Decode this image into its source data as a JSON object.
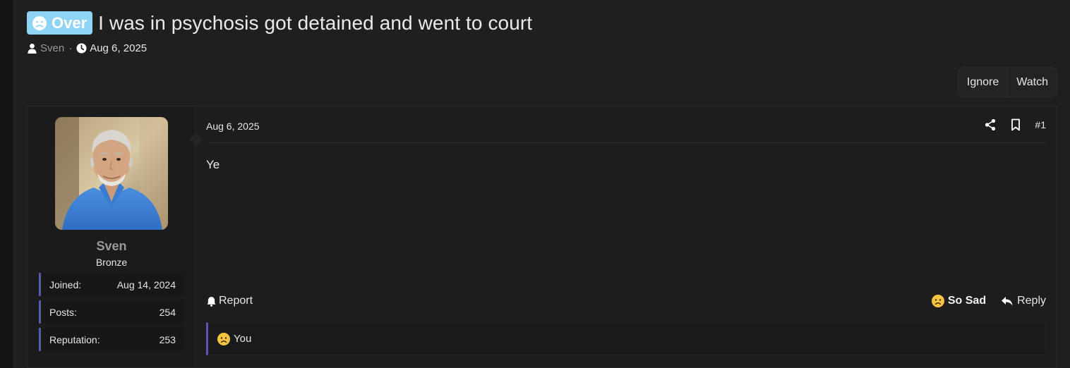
{
  "thread": {
    "prefix": "Over",
    "title": "I was in psychosis got detained and went to court",
    "author": "Sven",
    "separator": "·",
    "date": "Aug 6, 2025"
  },
  "actions": {
    "ignore": "Ignore",
    "watch": "Watch"
  },
  "user": {
    "name": "Sven",
    "title": "Bronze",
    "stats": [
      {
        "label": "Joined:",
        "value": "Aug 14, 2024"
      },
      {
        "label": "Posts:",
        "value": "254"
      },
      {
        "label": "Reputation:",
        "value": "253"
      }
    ]
  },
  "post": {
    "date": "Aug 6, 2025",
    "number": "#1",
    "body": "Ye",
    "report_label": "Report",
    "reaction_label": "So Sad",
    "reply_label": "Reply",
    "reactions_summary": "You"
  },
  "icons": {
    "prefix": "sad-face-icon",
    "author": "user-icon",
    "date": "clock-icon",
    "share": "share-icon",
    "bookmark": "bookmark-icon",
    "report": "bell-icon",
    "reaction": "sad-emoji-icon",
    "reply": "reply-arrow-icon"
  },
  "colors": {
    "prefix_badge": "#8fd3f5",
    "accent_border": "#5a58b6",
    "emoji": "#f5c542"
  }
}
